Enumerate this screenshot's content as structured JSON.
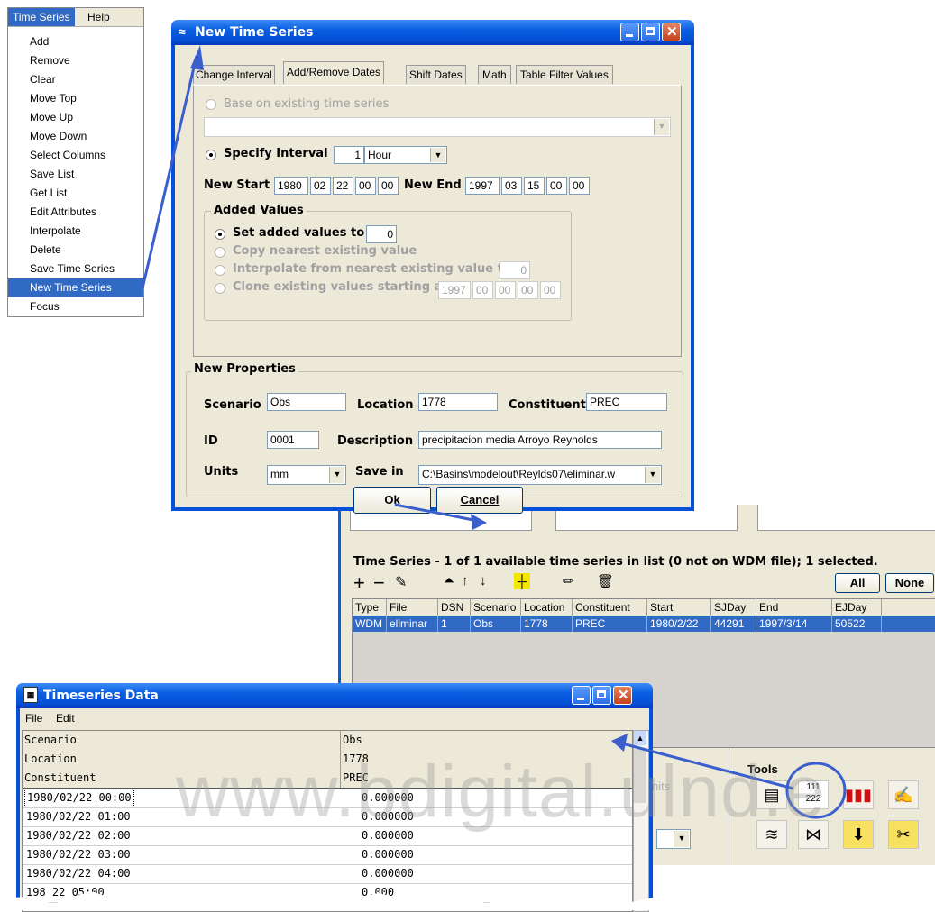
{
  "menu": {
    "bar": [
      "Time Series",
      "Help"
    ],
    "items": [
      "Add",
      "Remove",
      "Clear",
      "Move Top",
      "Move Up",
      "Move Down",
      "Select Columns",
      "Save List",
      "Get List",
      "Edit Attributes",
      "Interpolate",
      "Delete",
      "Save Time Series",
      "New Time Series",
      "Focus"
    ],
    "selected_index": 13
  },
  "dialog": {
    "title": "New Time Series",
    "tabs": [
      "Change Interval",
      "Add/Remove Dates",
      "Shift Dates",
      "Math",
      "Table Filter Values"
    ],
    "active_tab": 1,
    "base_existing_label": "Base on existing time series",
    "specify_interval_label": "Specify Interval",
    "interval_count": "1",
    "interval_unit": "Hour",
    "new_start_label": "New Start",
    "new_start": [
      "1980",
      "02",
      "22",
      "00",
      "00"
    ],
    "new_end_label": "New End",
    "new_end": [
      "1997",
      "03",
      "15",
      "00",
      "00"
    ],
    "added_values_title": "Added Values",
    "set_added_label": "Set added values to",
    "set_added_value": "0",
    "copy_nearest_label": "Copy nearest existing value",
    "interpolate_label": "Interpolate from nearest existing value to",
    "interpolate_value": "0",
    "clone_label": "Clone existing values starting at",
    "clone_date": [
      "1997",
      "00",
      "00",
      "00",
      "00"
    ],
    "new_props_title": "New Properties",
    "scenario_label": "Scenario",
    "scenario": "Obs",
    "location_label": "Location",
    "location": "1778",
    "constituent_label": "Constituent",
    "constituent": "PREC",
    "id_label": "ID",
    "id": "0001",
    "description_label": "Description",
    "description": "precipitacion media Arroyo Reynolds",
    "units_label": "Units",
    "units": "mm",
    "save_in_label": "Save in",
    "save_in": "C:\\Basins\\modelout\\Reylds07\\eliminar.w",
    "ok_label": "Ok",
    "cancel_label": "Cancel"
  },
  "tslist": {
    "header": "Time Series  -  1 of 1 available time series in list (0 not on WDM file);  1 selected.",
    "all_label": "All",
    "none_label": "None",
    "columns": [
      "Type",
      "File",
      "DSN",
      "Scenario",
      "Location",
      "Constituent",
      "Start",
      "SJDay",
      "End",
      "EJDay"
    ],
    "row": [
      "WDM",
      "eliminar",
      "1",
      "Obs",
      "1778",
      "PREC",
      "1980/2/22",
      "44291",
      "1997/3/14",
      "50522"
    ],
    "tools_label": "Tools",
    "units_partial": "nits"
  },
  "tsdata": {
    "title": "Timeseries Data",
    "menu": [
      "File",
      "Edit"
    ],
    "attr_rows": [
      [
        "Scenario",
        "Obs"
      ],
      [
        "Location",
        "1778"
      ],
      [
        "Constituent",
        "PREC"
      ]
    ],
    "data_rows": [
      [
        "1980/02/22 00:00",
        "0.000000"
      ],
      [
        "1980/02/22 01:00",
        "0.000000"
      ],
      [
        "1980/02/22 02:00",
        "0.000000"
      ],
      [
        "1980/02/22 03:00",
        "0.000000"
      ],
      [
        "1980/02/22 04:00",
        "0.000000"
      ],
      [
        "198   22 05:00",
        "0.000"
      ]
    ]
  },
  "watermark": "www.bdigital.ulnd.e",
  "colors": {
    "accent": "#316ac5",
    "title_blue": "#0450d8",
    "arrow": "#3a5fcd"
  }
}
